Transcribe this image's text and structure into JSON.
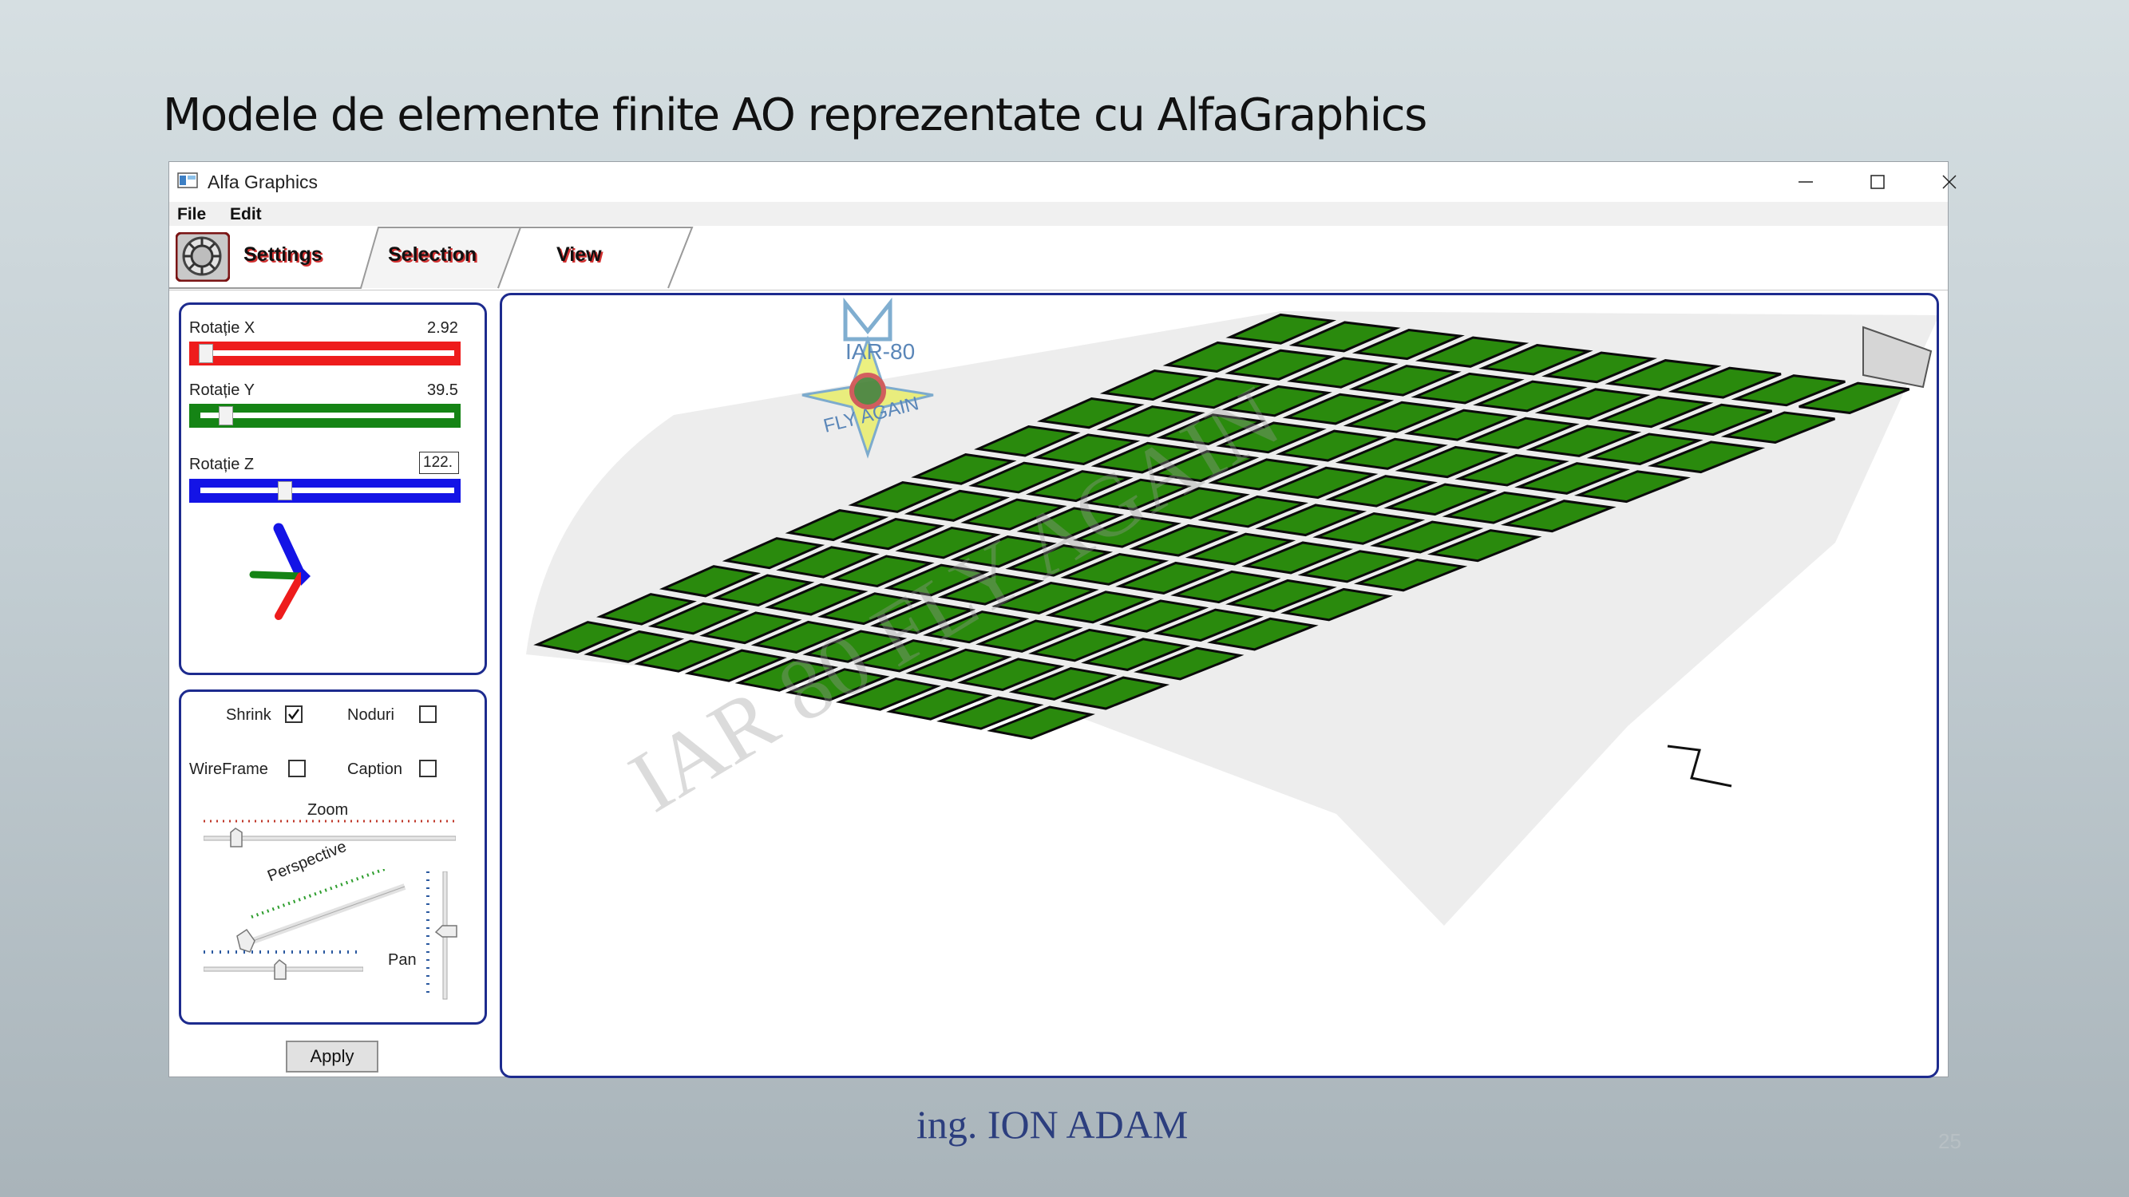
{
  "slide": {
    "title": "Modele de elemente finite AO reprezentate cu AlfaGraphics",
    "author": "ing. ION ADAM",
    "page_number": "25"
  },
  "window": {
    "title": "Alfa Graphics",
    "controls": [
      "minimize-icon",
      "maximize-icon",
      "close-icon"
    ]
  },
  "menu": {
    "file": "File",
    "edit": "Edit"
  },
  "tabs": {
    "settings": "Settings",
    "selection": "Selection",
    "view": "View",
    "active": "View"
  },
  "rotation": {
    "x": {
      "label": "Rotație X",
      "value": "2.92",
      "level": 0.03,
      "color": "#ee1c1c"
    },
    "y": {
      "label": "Rotație Y",
      "value": "39.5",
      "level": 0.11,
      "color": "#158415"
    },
    "z": {
      "label": "Rotație Z",
      "value": "122.",
      "level": 0.34,
      "color": "#1414e6"
    }
  },
  "options": {
    "shrink": {
      "label": "Shrink",
      "checked": true
    },
    "noduri": {
      "label": "Noduri",
      "checked": false
    },
    "wireframe": {
      "label": "WireFrame",
      "checked": false
    },
    "caption": {
      "label": "Caption",
      "checked": false
    }
  },
  "sliders": {
    "zoom": "Zoom",
    "perspective": "Perspective",
    "pan": "Pan"
  },
  "apply_label": "Apply",
  "viewport": {
    "watermark": "IAR 80 FLY AGAIN",
    "logo_text_top": "IAR-80",
    "logo_text_bottom": "FLY AGAIN",
    "mesh_color": "#2a8a0d",
    "frame_color": "#1d2b8e"
  }
}
